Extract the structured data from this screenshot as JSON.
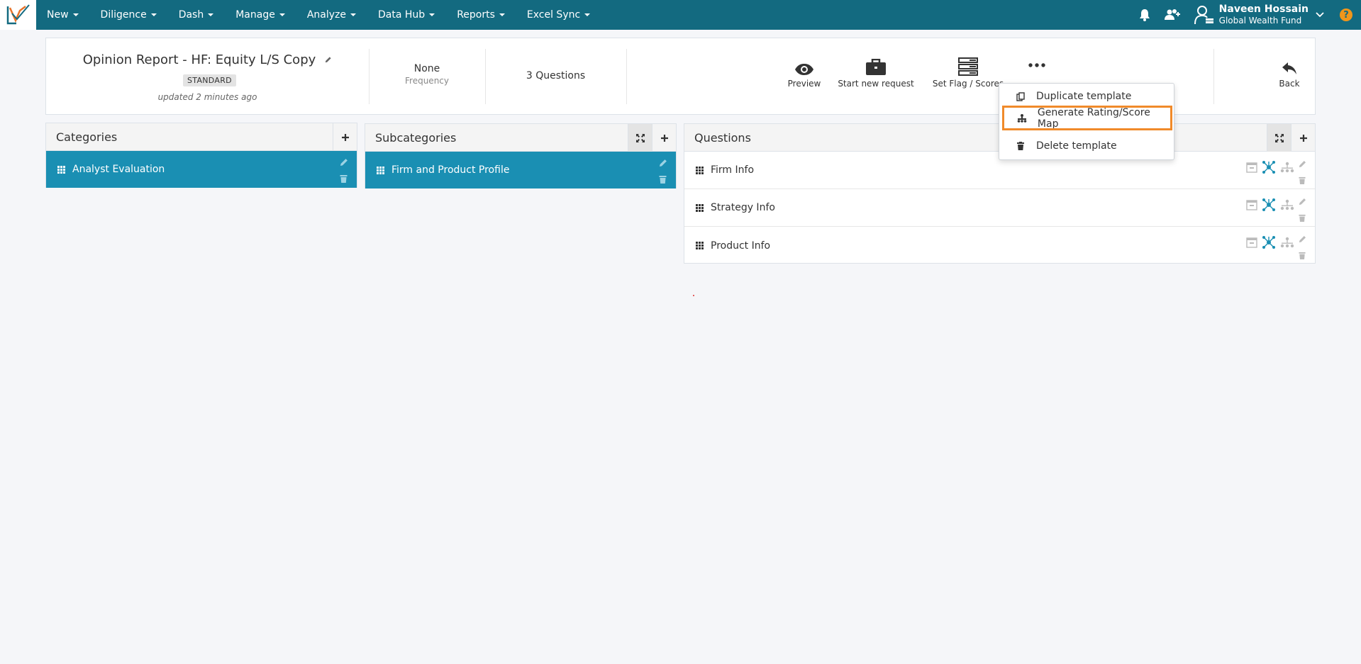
{
  "nav": {
    "items": [
      {
        "label": "New"
      },
      {
        "label": "Diligence"
      },
      {
        "label": "Dash"
      },
      {
        "label": "Manage"
      },
      {
        "label": "Analyze"
      },
      {
        "label": "Data Hub"
      },
      {
        "label": "Reports"
      },
      {
        "label": "Excel Sync"
      }
    ],
    "user": {
      "name": "Naveen Hossain",
      "org": "Global Wealth Fund"
    },
    "help_label": "?"
  },
  "header": {
    "title": "Opinion Report - HF: Equity L/S Copy",
    "badge": "STANDARD",
    "updated": "updated 2 minutes ago",
    "frequency_value": "None",
    "frequency_label": "Frequency",
    "questions_count": "3 Questions",
    "actions": {
      "preview": "Preview",
      "start_new_request": "Start new request",
      "set_flag_scores": "Set Flag / Scores",
      "back": "Back"
    }
  },
  "dropdown": {
    "items": [
      {
        "label": "Duplicate template"
      },
      {
        "label": "Generate Rating/Score Map"
      },
      {
        "label": "Delete template"
      }
    ]
  },
  "categories": {
    "title": "Categories",
    "items": [
      {
        "label": "Analyst Evaluation"
      }
    ]
  },
  "subcategories": {
    "title": "Subcategories",
    "items": [
      {
        "label": "Firm and Product Profile"
      }
    ]
  },
  "questions": {
    "title": "Questions",
    "items": [
      {
        "label": "Firm Info"
      },
      {
        "label": "Strategy Info"
      },
      {
        "label": "Product Info"
      }
    ]
  },
  "colors": {
    "nav_bg": "#136a80",
    "selected_row": "#1a8fb3",
    "highlight": "#f08a2a",
    "help": "#f0961b"
  }
}
